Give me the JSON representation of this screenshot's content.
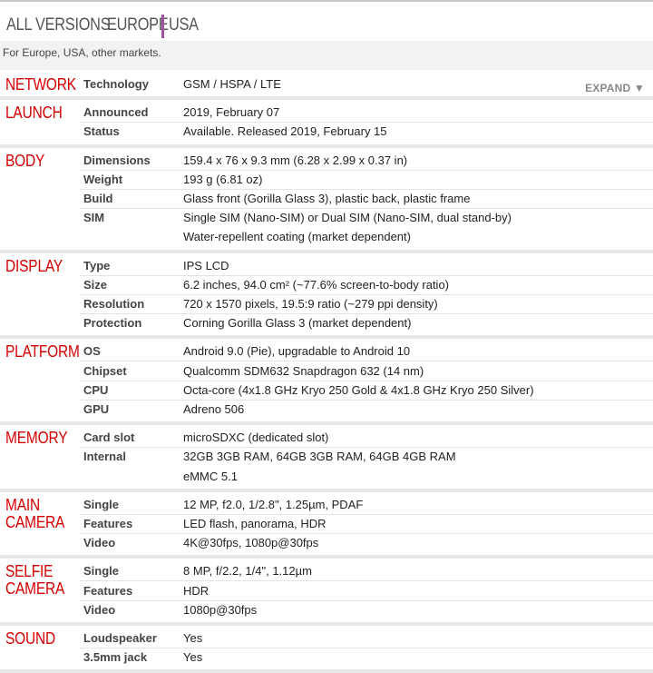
{
  "tabs": {
    "all_versions": "ALL VERSIONS",
    "europe": "EUROPE",
    "usa": "USA"
  },
  "note": "For Europe, USA, other markets.",
  "expand_label": "EXPAND ▼",
  "sections": [
    {
      "category": "NETWORK",
      "rows": [
        {
          "label": "Technology",
          "value": "GSM / HSPA / LTE"
        }
      ]
    },
    {
      "category": "LAUNCH",
      "rows": [
        {
          "label": "Announced",
          "value": "2019, February 07"
        },
        {
          "label": "Status",
          "value": "Available. Released 2019, February 15"
        }
      ]
    },
    {
      "category": "BODY",
      "rows": [
        {
          "label": "Dimensions",
          "value": "159.4 x 76 x 9.3 mm (6.28 x 2.99 x 0.37 in)"
        },
        {
          "label": "Weight",
          "value": "193 g (6.81 oz)"
        },
        {
          "label": "Build",
          "value": "Glass front (Gorilla Glass 3), plastic back, plastic frame"
        },
        {
          "label": "SIM",
          "value": "Single SIM (Nano-SIM) or Dual SIM (Nano-SIM, dual stand-by)"
        },
        {
          "label": "",
          "value": "Water-repellent coating (market dependent)"
        }
      ]
    },
    {
      "category": "DISPLAY",
      "rows": [
        {
          "label": "Type",
          "value": "IPS LCD"
        },
        {
          "label": "Size",
          "value": "6.2 inches, 94.0 cm² (~77.6% screen-to-body ratio)"
        },
        {
          "label": "Resolution",
          "value": "720 x 1570 pixels, 19.5:9 ratio (~279 ppi density)"
        },
        {
          "label": "Protection",
          "value": "Corning Gorilla Glass 3 (market dependent)"
        }
      ]
    },
    {
      "category": "PLATFORM",
      "rows": [
        {
          "label": "OS",
          "value": "Android 9.0 (Pie), upgradable to Android 10"
        },
        {
          "label": "Chipset",
          "value": "Qualcomm SDM632 Snapdragon 632 (14 nm)"
        },
        {
          "label": "CPU",
          "value": "Octa-core (4x1.8 GHz Kryo 250 Gold & 4x1.8 GHz Kryo 250 Silver)"
        },
        {
          "label": "GPU",
          "value": "Adreno 506"
        }
      ]
    },
    {
      "category": "MEMORY",
      "rows": [
        {
          "label": "Card slot",
          "value": "microSDXC (dedicated slot)"
        },
        {
          "label": "Internal",
          "value": "32GB 3GB RAM, 64GB 3GB RAM, 64GB 4GB RAM"
        },
        {
          "label": "",
          "value": "eMMC 5.1"
        }
      ]
    },
    {
      "category": "MAIN\nCAMERA",
      "rows": [
        {
          "label": "Single",
          "value": "12 MP, f2.0, 1/2.8\", 1.25µm, PDAF"
        },
        {
          "label": "Features",
          "value": "LED flash, panorama, HDR"
        },
        {
          "label": "Video",
          "value": "4K@30fps, 1080p@30fps"
        }
      ]
    },
    {
      "category": "SELFIE\nCAMERA",
      "rows": [
        {
          "label": "Single",
          "value": "8 MP, f/2.2, 1/4\", 1.12µm"
        },
        {
          "label": "Features",
          "value": "HDR"
        },
        {
          "label": "Video",
          "value": "1080p@30fps"
        }
      ]
    },
    {
      "category": "SOUND",
      "rows": [
        {
          "label": "Loudspeaker",
          "value": "Yes"
        },
        {
          "label": "3.5mm jack",
          "value": "Yes"
        }
      ]
    }
  ]
}
